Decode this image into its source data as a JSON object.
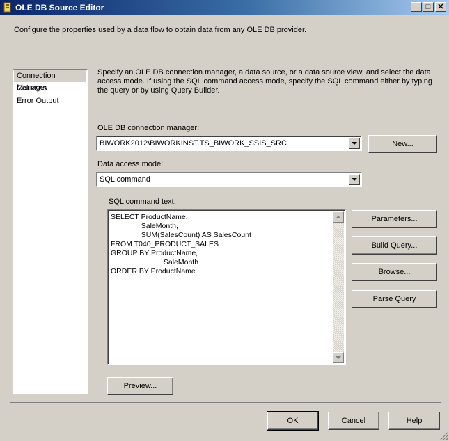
{
  "window": {
    "title": "OLE DB Source Editor",
    "controls": {
      "minimize": "_",
      "maximize": "□",
      "close": "✕"
    }
  },
  "description": "Configure the properties used by a data flow to obtain data from any OLE DB provider.",
  "nav": {
    "items": [
      {
        "label": "Connection Manager",
        "selected": true
      },
      {
        "label": "Columns",
        "selected": false
      },
      {
        "label": "Error Output",
        "selected": false
      }
    ]
  },
  "main": {
    "info": "Specify an OLE DB connection manager, a data source, or a data source view, and select the data access mode. If using the SQL command access mode, specify the SQL command either by typing the query or by using Query Builder.",
    "connection_label": "OLE DB connection manager:",
    "connection_value": "BIWORK2012\\BIWORKINST.TS_BIWORK_SSIS_SRC",
    "new_button": "New...",
    "access_mode_label": "Data access mode:",
    "access_mode_value": "SQL command",
    "sql_label": "SQL command text:",
    "sql_text": "SELECT ProductName,\n               SaleMonth,\n               SUM(SalesCount) AS SalesCount\nFROM T040_PRODUCT_SALES\nGROUP BY ProductName,\n                          SaleMonth\nORDER BY ProductName",
    "parameters_button": "Parameters...",
    "build_query_button": "Build Query...",
    "browse_button": "Browse...",
    "parse_query_button": "Parse Query",
    "preview_button": "Preview..."
  },
  "footer": {
    "ok": "OK",
    "cancel": "Cancel",
    "help": "Help"
  }
}
